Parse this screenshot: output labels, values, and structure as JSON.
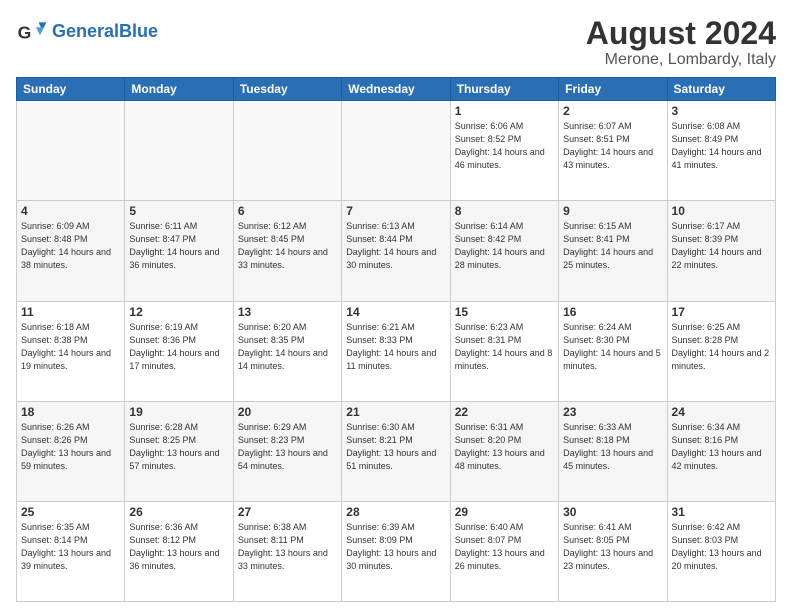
{
  "header": {
    "logo_general": "General",
    "logo_blue": "Blue",
    "title": "August 2024",
    "subtitle": "Merone, Lombardy, Italy"
  },
  "weekdays": [
    "Sunday",
    "Monday",
    "Tuesday",
    "Wednesday",
    "Thursday",
    "Friday",
    "Saturday"
  ],
  "weeks": [
    [
      {
        "day": "",
        "info": ""
      },
      {
        "day": "",
        "info": ""
      },
      {
        "day": "",
        "info": ""
      },
      {
        "day": "",
        "info": ""
      },
      {
        "day": "1",
        "info": "Sunrise: 6:06 AM\nSunset: 8:52 PM\nDaylight: 14 hours\nand 46 minutes."
      },
      {
        "day": "2",
        "info": "Sunrise: 6:07 AM\nSunset: 8:51 PM\nDaylight: 14 hours\nand 43 minutes."
      },
      {
        "day": "3",
        "info": "Sunrise: 6:08 AM\nSunset: 8:49 PM\nDaylight: 14 hours\nand 41 minutes."
      }
    ],
    [
      {
        "day": "4",
        "info": "Sunrise: 6:09 AM\nSunset: 8:48 PM\nDaylight: 14 hours\nand 38 minutes."
      },
      {
        "day": "5",
        "info": "Sunrise: 6:11 AM\nSunset: 8:47 PM\nDaylight: 14 hours\nand 36 minutes."
      },
      {
        "day": "6",
        "info": "Sunrise: 6:12 AM\nSunset: 8:45 PM\nDaylight: 14 hours\nand 33 minutes."
      },
      {
        "day": "7",
        "info": "Sunrise: 6:13 AM\nSunset: 8:44 PM\nDaylight: 14 hours\nand 30 minutes."
      },
      {
        "day": "8",
        "info": "Sunrise: 6:14 AM\nSunset: 8:42 PM\nDaylight: 14 hours\nand 28 minutes."
      },
      {
        "day": "9",
        "info": "Sunrise: 6:15 AM\nSunset: 8:41 PM\nDaylight: 14 hours\nand 25 minutes."
      },
      {
        "day": "10",
        "info": "Sunrise: 6:17 AM\nSunset: 8:39 PM\nDaylight: 14 hours\nand 22 minutes."
      }
    ],
    [
      {
        "day": "11",
        "info": "Sunrise: 6:18 AM\nSunset: 8:38 PM\nDaylight: 14 hours\nand 19 minutes."
      },
      {
        "day": "12",
        "info": "Sunrise: 6:19 AM\nSunset: 8:36 PM\nDaylight: 14 hours\nand 17 minutes."
      },
      {
        "day": "13",
        "info": "Sunrise: 6:20 AM\nSunset: 8:35 PM\nDaylight: 14 hours\nand 14 minutes."
      },
      {
        "day": "14",
        "info": "Sunrise: 6:21 AM\nSunset: 8:33 PM\nDaylight: 14 hours\nand 11 minutes."
      },
      {
        "day": "15",
        "info": "Sunrise: 6:23 AM\nSunset: 8:31 PM\nDaylight: 14 hours\nand 8 minutes."
      },
      {
        "day": "16",
        "info": "Sunrise: 6:24 AM\nSunset: 8:30 PM\nDaylight: 14 hours\nand 5 minutes."
      },
      {
        "day": "17",
        "info": "Sunrise: 6:25 AM\nSunset: 8:28 PM\nDaylight: 14 hours\nand 2 minutes."
      }
    ],
    [
      {
        "day": "18",
        "info": "Sunrise: 6:26 AM\nSunset: 8:26 PM\nDaylight: 13 hours\nand 59 minutes."
      },
      {
        "day": "19",
        "info": "Sunrise: 6:28 AM\nSunset: 8:25 PM\nDaylight: 13 hours\nand 57 minutes."
      },
      {
        "day": "20",
        "info": "Sunrise: 6:29 AM\nSunset: 8:23 PM\nDaylight: 13 hours\nand 54 minutes."
      },
      {
        "day": "21",
        "info": "Sunrise: 6:30 AM\nSunset: 8:21 PM\nDaylight: 13 hours\nand 51 minutes."
      },
      {
        "day": "22",
        "info": "Sunrise: 6:31 AM\nSunset: 8:20 PM\nDaylight: 13 hours\nand 48 minutes."
      },
      {
        "day": "23",
        "info": "Sunrise: 6:33 AM\nSunset: 8:18 PM\nDaylight: 13 hours\nand 45 minutes."
      },
      {
        "day": "24",
        "info": "Sunrise: 6:34 AM\nSunset: 8:16 PM\nDaylight: 13 hours\nand 42 minutes."
      }
    ],
    [
      {
        "day": "25",
        "info": "Sunrise: 6:35 AM\nSunset: 8:14 PM\nDaylight: 13 hours\nand 39 minutes."
      },
      {
        "day": "26",
        "info": "Sunrise: 6:36 AM\nSunset: 8:12 PM\nDaylight: 13 hours\nand 36 minutes."
      },
      {
        "day": "27",
        "info": "Sunrise: 6:38 AM\nSunset: 8:11 PM\nDaylight: 13 hours\nand 33 minutes."
      },
      {
        "day": "28",
        "info": "Sunrise: 6:39 AM\nSunset: 8:09 PM\nDaylight: 13 hours\nand 30 minutes."
      },
      {
        "day": "29",
        "info": "Sunrise: 6:40 AM\nSunset: 8:07 PM\nDaylight: 13 hours\nand 26 minutes."
      },
      {
        "day": "30",
        "info": "Sunrise: 6:41 AM\nSunset: 8:05 PM\nDaylight: 13 hours\nand 23 minutes."
      },
      {
        "day": "31",
        "info": "Sunrise: 6:42 AM\nSunset: 8:03 PM\nDaylight: 13 hours\nand 20 minutes."
      }
    ]
  ]
}
